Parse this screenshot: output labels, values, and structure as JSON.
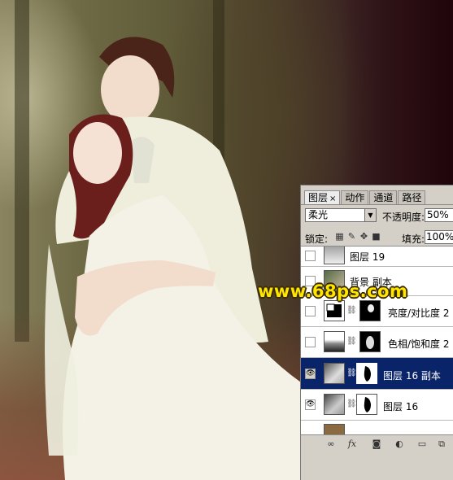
{
  "panel": {
    "tabs": [
      {
        "label": "图层",
        "close": "×"
      },
      {
        "label": "动作"
      },
      {
        "label": "通道"
      },
      {
        "label": "路径"
      }
    ],
    "blend_mode": "柔光",
    "opacity_label": "不透明度:",
    "opacity_value": "50%",
    "lock_label": "锁定:",
    "fill_label": "填充:",
    "fill_value": "100%",
    "layers": [
      {
        "name": "图层 19",
        "visible": false,
        "selected": false,
        "has_mask": false
      },
      {
        "name": "背景 副本",
        "visible": false,
        "selected": false,
        "has_mask": false
      },
      {
        "name": "亮度/对比度 2",
        "visible": false,
        "selected": false,
        "has_mask": true,
        "adjustment": true
      },
      {
        "name": "色相/饱和度 2",
        "visible": false,
        "selected": false,
        "has_mask": true,
        "adjustment": true
      },
      {
        "name": "图层 16 副本",
        "visible": true,
        "selected": true,
        "has_mask": true
      },
      {
        "name": "图层 16",
        "visible": true,
        "selected": false,
        "has_mask": true
      }
    ],
    "bottom_icons": [
      "link-icon",
      "fx-icon",
      "add-mask-icon",
      "adjustment-icon",
      "new-group-icon",
      "new-layer-icon"
    ]
  },
  "watermark": "www.68ps.com",
  "colors": {
    "selection": "#0a246a",
    "watermark": "#ffe600"
  }
}
